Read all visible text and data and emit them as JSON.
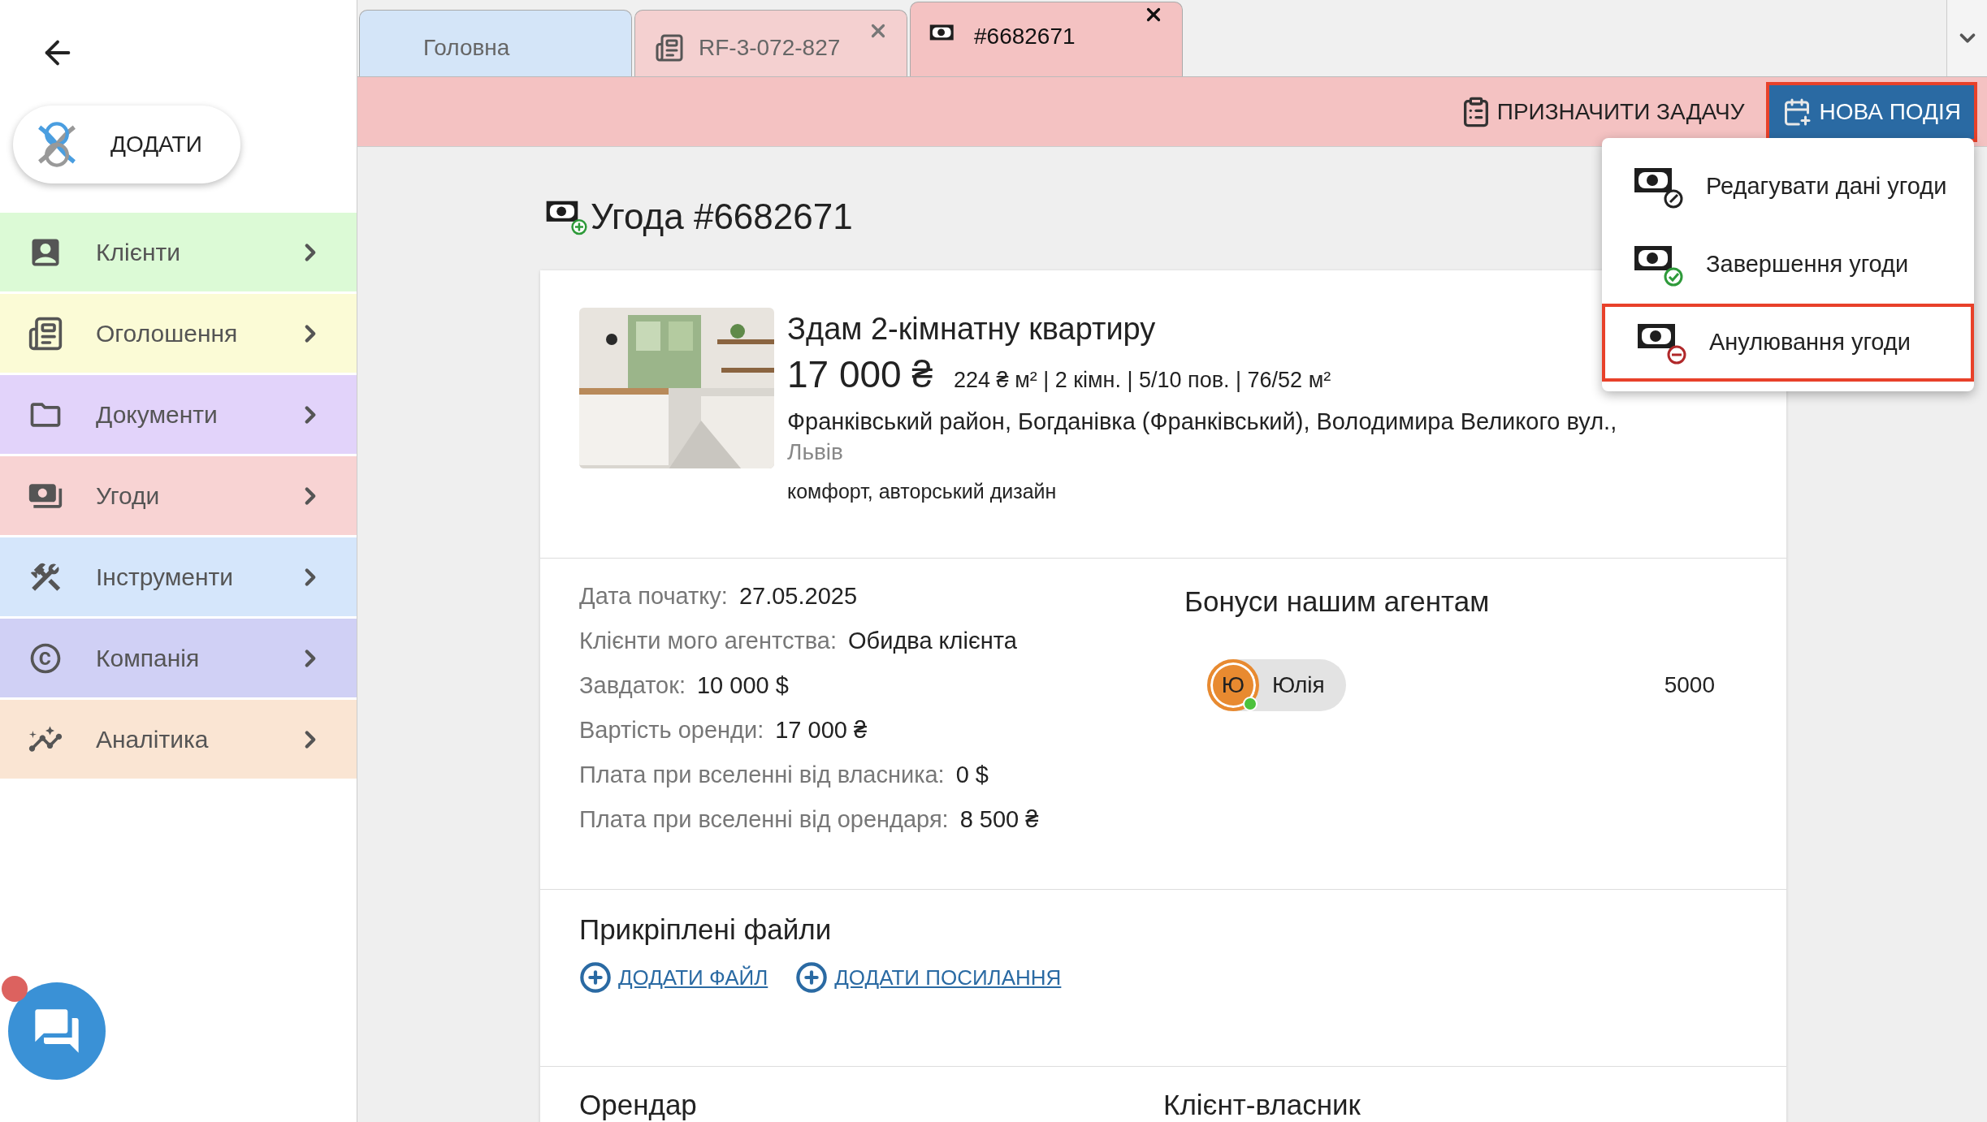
{
  "add_button": {
    "label": "ДОДАТИ"
  },
  "sidebar": {
    "items": [
      {
        "label": "Клієнти",
        "kind": "clients",
        "color": "#dcfad6"
      },
      {
        "label": "Оголошення",
        "kind": "listings",
        "color": "#fbfbd6"
      },
      {
        "label": "Документи",
        "kind": "documents",
        "color": "#e2d3fa"
      },
      {
        "label": "Угоди",
        "kind": "deals",
        "color": "#f8d3d3"
      },
      {
        "label": "Інструменти",
        "kind": "tools",
        "color": "#d5e6fb"
      },
      {
        "label": "Компанія",
        "kind": "company",
        "color": "#d0d0f5"
      },
      {
        "label": "Аналітика",
        "kind": "analytics",
        "color": "#fae5d3"
      }
    ]
  },
  "chat": {
    "unread": true
  },
  "tabs": [
    {
      "label": "Головна",
      "kind": "home",
      "selected": false,
      "closable": false,
      "color": "#d4e5f8"
    },
    {
      "label": "RF-3-072-827",
      "kind": "listing",
      "selected": false,
      "closable": true,
      "color": "#f4d0d0"
    },
    {
      "label": "#6682671",
      "kind": "deal",
      "selected": true,
      "closable": true,
      "color": "#f4c2c2"
    }
  ],
  "toolbar": {
    "assign_task": "ПРИЗНАЧИТИ ЗАДАЧУ",
    "new_event": {
      "label": "НОВА ПОДІЯ",
      "expanded": true
    }
  },
  "menu": {
    "items": [
      {
        "label": "Редагувати дані угоди",
        "kind": "edit",
        "selected": false
      },
      {
        "label": "Завершення угоди",
        "kind": "complete",
        "selected": false
      },
      {
        "label": "Анулювання угоди",
        "kind": "cancel",
        "selected": true
      }
    ]
  },
  "deal": {
    "title": "Угода #6682671",
    "listing": {
      "title": "Здам 2-кімнатну квартиру",
      "price": "17 000 ₴",
      "specs": "224 ₴ м² | 2 кімн. | 5/10 пов. | 76/52 м²",
      "address": "Франківський район, Богданівка (Франківський), Володимира Великого вул.,",
      "city": "Львів",
      "features": "комфорт, авторський дизайн"
    },
    "details": [
      {
        "label": "Дата початку:",
        "value": "27.05.2025"
      },
      {
        "label": "Клієнти мого агентства:",
        "value": "Обидва клієнта"
      },
      {
        "label": "Завдаток:",
        "value": "10 000 $"
      },
      {
        "label": "Вартість оренди:",
        "value": "17 000 ₴"
      },
      {
        "label": "Плата при вселенні від власника:",
        "value": "0 $"
      },
      {
        "label": "Плата при вселенні від орендаря:",
        "value": "8 500 ₴"
      }
    ],
    "bonuses": {
      "title": "Бонуси нашим агентам",
      "agents": [
        {
          "initial": "Ю",
          "name": "Юлія",
          "online": true,
          "amount": "5000"
        }
      ]
    },
    "files": {
      "title": "Прикріплені файли",
      "links": [
        "ДОДАТИ ФАЙЛ",
        "ДОДАТИ ПОСИЛАННЯ"
      ]
    },
    "parties": [
      "Орендар",
      "Клієнт-власник"
    ]
  }
}
